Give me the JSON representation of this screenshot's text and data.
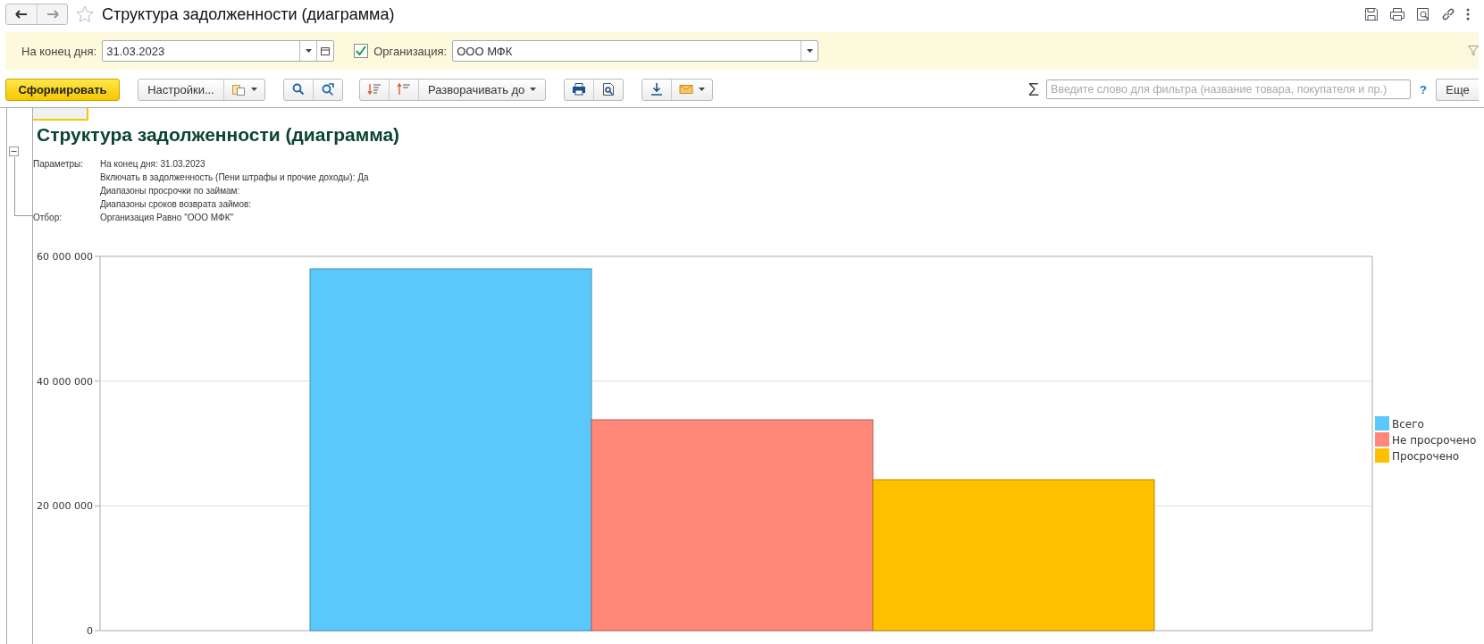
{
  "window": {
    "title": "Структура задолженности (диаграмма)"
  },
  "filters": {
    "date": {
      "label": "На конец дня:",
      "value": "31.03.2023"
    },
    "organization": {
      "checked": true,
      "label": "Организация:",
      "value": "ООО МФК"
    }
  },
  "toolbar": {
    "generate_button": "Сформировать",
    "settings_button": "Настройки...",
    "expand_button": "Разворачивать до",
    "sum_symbol": "Σ",
    "search": {
      "placeholder": "Введите слово для фильтра (название товара, покупателя и пр.)"
    },
    "help": "?",
    "more_button": "Еще"
  },
  "report": {
    "title": "Структура задолженности (диаграмма)",
    "group_expanded": true,
    "parameters": [
      {
        "label": "Параметры:",
        "value": "На конец дня: 31.03.2023"
      },
      {
        "value": "Включать в задолженность (Пени штрафы и прочие доходы): Да"
      },
      {
        "value": "Диапазоны просрочки по займам:"
      },
      {
        "value": "Диапазоны сроков возврата займов:"
      },
      {
        "label": "Отбор:",
        "value": "Организация Равно \"ООО МФК\""
      }
    ],
    "chart_data": {
      "type": "bar",
      "categories": [
        null
      ],
      "legend": "right",
      "series": [
        {
          "name": "Всего",
          "color": "#5bc8fc",
          "values": [
            58000000
          ]
        },
        {
          "name": "Не просрочено",
          "color": "#ff8878",
          "values": [
            33800000
          ]
        },
        {
          "name": "Просрочено",
          "color": "#ffc000",
          "values": [
            24200000
          ]
        }
      ],
      "ylim": [
        0,
        60000000
      ],
      "yticks": [
        {
          "value": 0,
          "label": "0"
        },
        {
          "value": 20000000,
          "label": "20 000 000"
        },
        {
          "value": 40000000,
          "label": "40 000 000"
        },
        {
          "value": 60000000,
          "label": "60 000 000"
        }
      ]
    }
  }
}
